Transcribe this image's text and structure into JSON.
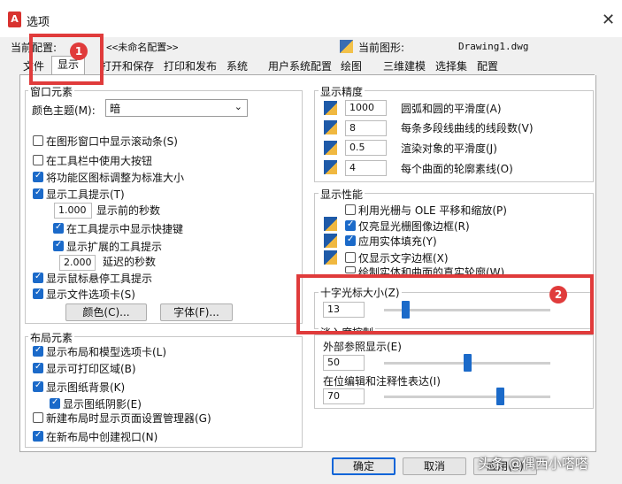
{
  "window": {
    "title": "选项",
    "close_glyph": "✕"
  },
  "profile": {
    "label": "当前配置:",
    "value": "<<未命名配置>>"
  },
  "drawing": {
    "label": "当前图形:",
    "value": "Drawing1.dwg"
  },
  "tabs": [
    "文件",
    "显示",
    "打开和保存",
    "打印和发布",
    "系统",
    "用户系统配置",
    "绘图",
    "三维建模",
    "选择集",
    "配置"
  ],
  "active_tab": "显示",
  "window_elements": {
    "title": "窗口元素",
    "color_theme_label": "颜色主题(M):",
    "color_theme_value": "暗",
    "options": [
      {
        "label": "在图形窗口中显示滚动条(S)",
        "checked": false
      },
      {
        "label": "在工具栏中使用大按钮",
        "checked": false
      },
      {
        "label": "将功能区图标调整为标准大小",
        "checked": true
      },
      {
        "label": "显示工具提示(T)",
        "checked": true
      }
    ],
    "tooltip_delay_value": "1.000",
    "tooltip_delay_label": "显示前的秒数",
    "show_shortcut_label": "在工具提示中显示快捷键",
    "show_extended_label": "显示扩展的工具提示",
    "extended_delay_value": "2.000",
    "extended_delay_label": "延迟的秒数",
    "rollover_label": "显示鼠标悬停工具提示",
    "file_tabs_label": "显示文件选项卡(S)",
    "colors_button": "颜色(C)...",
    "fonts_button": "字体(F)..."
  },
  "layout_elements": {
    "title": "布局元素",
    "options": [
      {
        "label": "显示布局和模型选项卡(L)",
        "checked": true
      },
      {
        "label": "显示可打印区域(B)",
        "checked": true
      },
      {
        "label": "显示图纸背景(K)",
        "checked": true
      },
      {
        "label": "显示图纸阴影(E)",
        "checked": true
      },
      {
        "label": "新建布局时显示页面设置管理器(G)",
        "checked": false
      },
      {
        "label": "在新布局中创建视口(N)",
        "checked": true
      }
    ]
  },
  "display_resolution": {
    "title": "显示精度",
    "items": [
      {
        "value": "1000",
        "label": "圆弧和圆的平滑度(A)"
      },
      {
        "value": "8",
        "label": "每条多段线曲线的线段数(V)"
      },
      {
        "value": "0.5",
        "label": "渲染对象的平滑度(J)"
      },
      {
        "value": "4",
        "label": "每个曲面的轮廓素线(O)"
      }
    ]
  },
  "display_performance": {
    "title": "显示性能",
    "items": [
      {
        "label": "利用光栅与 OLE 平移和缩放(P)",
        "checked": false
      },
      {
        "label": "仅亮显光栅图像边框(R)",
        "checked": true
      },
      {
        "label": "应用实体填充(Y)",
        "checked": true
      },
      {
        "label": "仅显示文字边框(X)",
        "checked": false
      },
      {
        "label": "绘制实体和曲面的真实轮廓(W)",
        "checked": false
      }
    ]
  },
  "crosshair": {
    "title": "十字光标大小(Z)",
    "value": "13",
    "level_fraction": 0.13
  },
  "fade_control": {
    "title": "淡入度控制",
    "xref_label": "外部参照显示(E)",
    "xref_value": "50",
    "xref_fraction": 0.5,
    "inplace_label": "在位编辑和注释性表达(I)",
    "inplace_value": "70",
    "inplace_fraction": 0.7
  },
  "buttons": {
    "ok": "确定",
    "cancel": "取消",
    "apply": "应用(A)"
  },
  "annotations": {
    "badge1": "1",
    "badge2": "2",
    "red_accent": "#e03b3b"
  },
  "watermark": "头条 @偶西小嗒嗒"
}
